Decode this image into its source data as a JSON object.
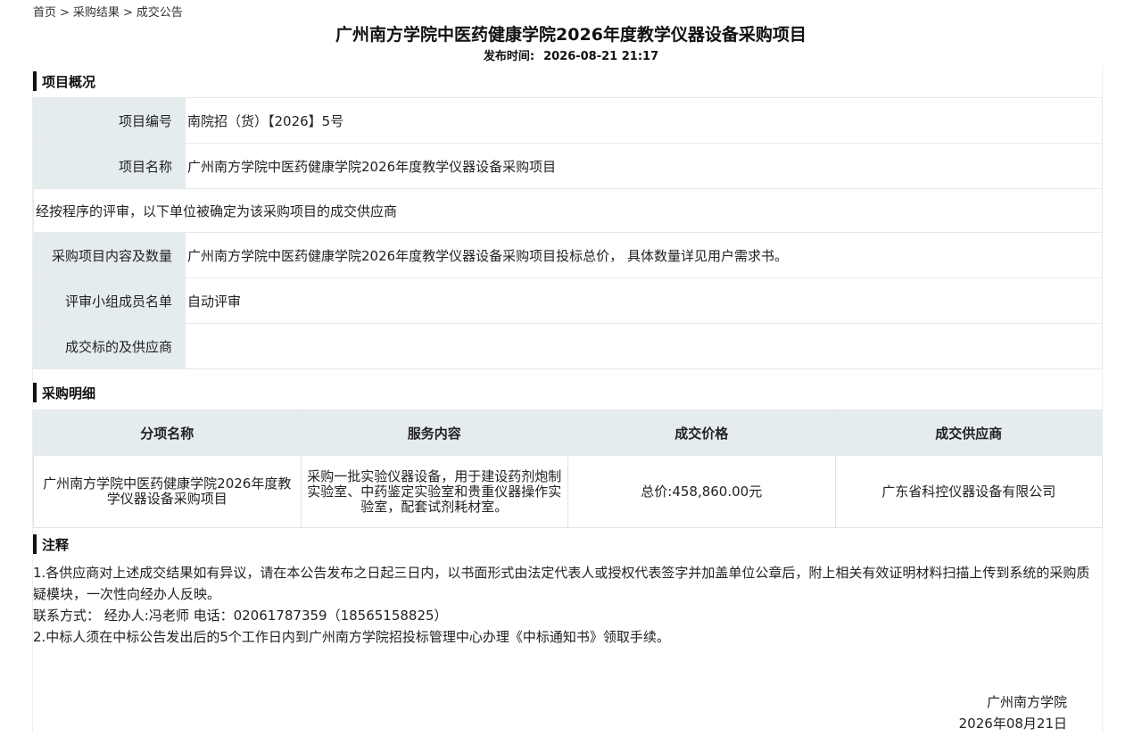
{
  "breadcrumb": {
    "items": [
      "首页",
      "采购结果",
      "成交公告"
    ],
    "separator": ">"
  },
  "header": {
    "title": "广州南方学院中医药健康学院2026年度教学仪器设备采购项目",
    "publish_label": "发布时间:",
    "publish_time": "2026-08-21 21:17"
  },
  "overview": {
    "section_title": "项目概况",
    "project_no_label": "项目编号",
    "project_no": "南院招（货）【2026】5号",
    "project_name_label": "项目名称",
    "project_name": "广州南方学院中医药健康学院2026年度教学仪器设备采购项目",
    "statement": "经按程序的评审，以下单位被确定为该采购项目的成交供应商",
    "content_label": "采购项目内容及数量",
    "content": "广州南方学院中医药健康学院2026年度教学仪器设备采购项目投标总价， 具体数量详见用户需求书。",
    "panel_label": "评审小组成员名单",
    "panel": "自动评审",
    "winner_label": "成交标的及供应商",
    "winner": ""
  },
  "details": {
    "section_title": "采购明细",
    "columns": [
      "分项名称",
      "服务内容",
      "成交价格",
      "成交供应商"
    ],
    "rows": [
      {
        "name": "广州南方学院中医药健康学院2026年度教学仪器设备采购项目",
        "service": "采购一批实验仪器设备，用于建设药剂炮制实验室、中药鉴定实验室和贵重仪器操作实验室，配套试剂耗材室。",
        "price": "总价:458,860.00元",
        "supplier": "广东省科控仪器设备有限公司"
      }
    ]
  },
  "notes": {
    "section_title": "注释",
    "line1": "1.各供应商对上述成交结果如有异议，请在本公告发布之日起三日内，以书面形式由法定代表人或授权代表签字并加盖单位公章后，附上相关有效证明材料扫描上传到系统的采购质疑模块，一次性向经办人反映。",
    "contact": "联系方式：  经办人:冯老师 电话：02061787359（18565158825）",
    "line2": "2.中标人须在中标公告发出后的5个工作日内到广州南方学院招投标管理中心办理《中标通知书》领取手续。"
  },
  "signature": {
    "org": "广州南方学院",
    "date": "2026年08月21日"
  }
}
